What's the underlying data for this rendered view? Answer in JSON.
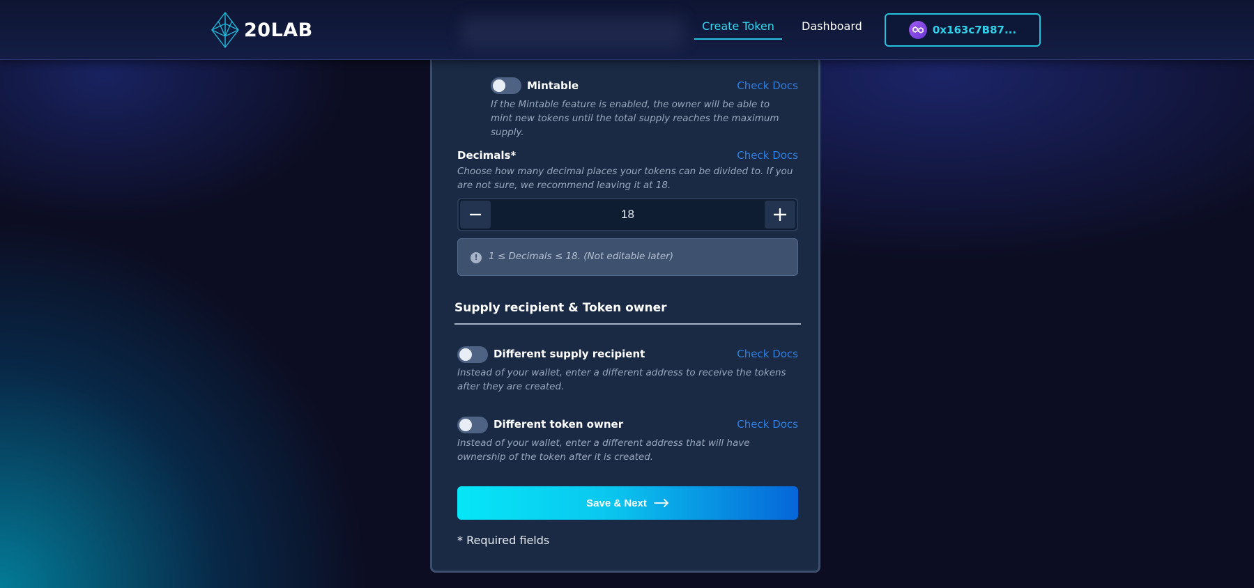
{
  "header": {
    "logo_text": "20LAB",
    "nav": {
      "create_token": "Create Token",
      "dashboard": "Dashboard"
    },
    "wallet": {
      "address": "0x163c7B87...",
      "icon": "polygon-icon"
    }
  },
  "form": {
    "mintable": {
      "label": "Mintable",
      "docs": "Check Docs",
      "enabled": false,
      "description": "If the Mintable feature is enabled, the owner will be able to mint new tokens until the total supply reaches the maximum supply."
    },
    "decimals": {
      "label": "Decimals*",
      "docs": "Check Docs",
      "description": "Choose how many decimal places your tokens can be divided to. If you are not sure, we recommend leaving it at 18.",
      "value": "18",
      "minus": "−",
      "plus": "+",
      "hint": "1 ≤ Decimals ≤ 18. (Not editable later)"
    },
    "section_title": "Supply recipient & Token owner",
    "supply_recipient": {
      "label": "Different supply recipient",
      "docs": "Check Docs",
      "enabled": false,
      "description": "Instead of your wallet, enter a different address to receive the tokens after they are created."
    },
    "token_owner": {
      "label": "Different token owner",
      "docs": "Check Docs",
      "enabled": false,
      "description": "Instead of your wallet, enter a different address that will have ownership of the token after it is created."
    },
    "save_button": "Save & Next",
    "required_note": "* Required fields"
  },
  "colors": {
    "accent": "#2fd0ea",
    "link": "#2f7fe0",
    "card": "#1a2a45"
  }
}
